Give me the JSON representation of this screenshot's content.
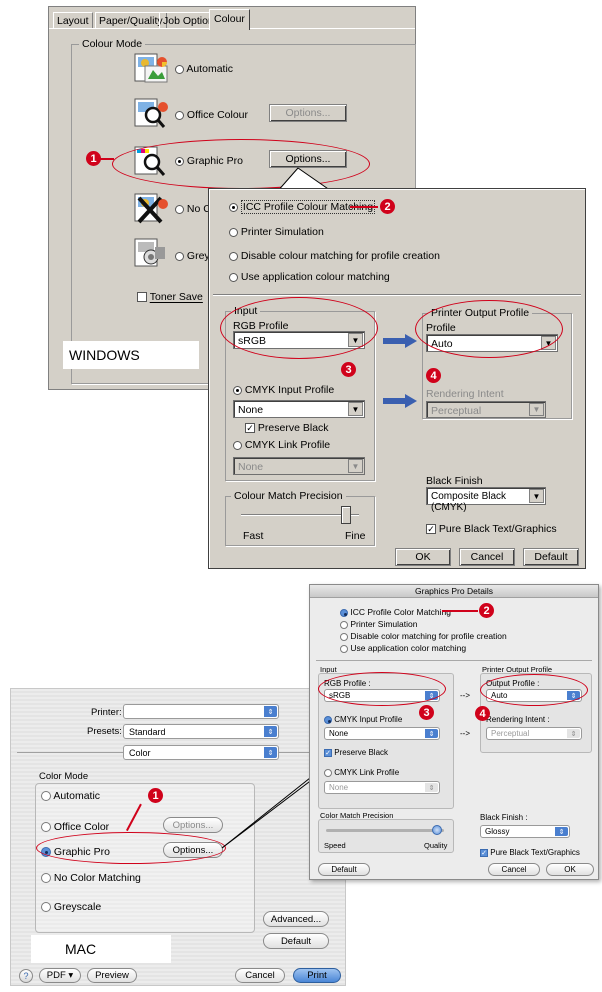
{
  "windows": {
    "tabs": [
      "Layout",
      "Paper/Quality",
      "Job Options",
      "Colour"
    ],
    "group_title": "Colour Mode",
    "modes": {
      "automatic": "Automatic",
      "office": "Office Colour",
      "graphic": "Graphic Pro",
      "nocolour": "No C",
      "grey": "Grey"
    },
    "options_label": "Options...",
    "toner_save": "Toner Save",
    "platform_label": "WINDOWS"
  },
  "win_dialog": {
    "radios": [
      "ICC Profile Colour Matching",
      "Printer Simulation",
      "Disable colour matching for profile creation",
      "Use application colour matching"
    ],
    "input_title": "Input",
    "rgb_profile_label": "RGB Profile",
    "rgb_profile_value": "sRGB",
    "cmyk_input_label": "CMYK Input Profile",
    "cmyk_input_value": "None",
    "preserve_black": "Preserve Black",
    "cmyk_link_label": "CMYK Link Profile",
    "cmyk_link_value": "None",
    "output_title": "Printer Output Profile",
    "profile_label": "Profile",
    "profile_value": "Auto",
    "rendering_label": "Rendering Intent",
    "rendering_value": "Perceptual",
    "precision_title": "Colour Match Precision",
    "fast": "Fast",
    "fine": "Fine",
    "black_finish_label": "Black Finish",
    "black_finish_value": "Composite Black (CMYK)",
    "pure_black": "Pure Black Text/Graphics",
    "ok": "OK",
    "cancel": "Cancel",
    "default": "Default"
  },
  "mac_dialog": {
    "title": "Graphics Pro Details",
    "radios": [
      "ICC Profile Color Matching",
      "Printer Simulation",
      "Disable color matching for profile creation",
      "Use application color matching"
    ],
    "input_title": "Input",
    "rgb_profile_label": "RGB Profile :",
    "rgb_profile_value": "sRGB",
    "cmyk_input_label": "CMYK Input Profile",
    "cmyk_input_value": "None",
    "preserve_black": "Preserve Black",
    "cmyk_link_label": "CMYK Link Profile",
    "cmyk_link_value": "None",
    "output_title": "Printer Output Profile",
    "output_label": "Output Profile :",
    "output_value": "Auto",
    "rendering_label": "Rendering Intent :",
    "rendering_value": "Perceptual",
    "arrow": "-->",
    "precision_title": "Color Match Precision",
    "speed": "Speed",
    "quality": "Quality",
    "black_finish_label": "Black Finish :",
    "black_finish_value": "Glossy",
    "pure_black": "Pure Black Text/Graphics",
    "default": "Default",
    "cancel": "Cancel",
    "ok": "OK"
  },
  "mac_print": {
    "printer_label": "Printer:",
    "printer_value": "",
    "presets_label": "Presets:",
    "presets_value": "Standard",
    "panel_value": "Color",
    "group_title": "Color Mode",
    "modes": {
      "automatic": "Automatic",
      "office": "Office Color",
      "graphic": "Graphic Pro",
      "nocolor": "No Color Matching",
      "greyscale": "Greyscale"
    },
    "options_label": "Options...",
    "advanced": "Advanced...",
    "default": "Default",
    "platform_label": "MAC",
    "help": "?",
    "pdf": "PDF ▾",
    "preview": "Preview",
    "cancel": "Cancel",
    "print": "Print"
  },
  "callouts": [
    "1",
    "2",
    "3",
    "4"
  ],
  "colors": {
    "callout_red": "#d0021b",
    "arrow_blue": "#3a5fb0",
    "win_face": "#d4d0c8",
    "mac_bg": "#ececec"
  }
}
